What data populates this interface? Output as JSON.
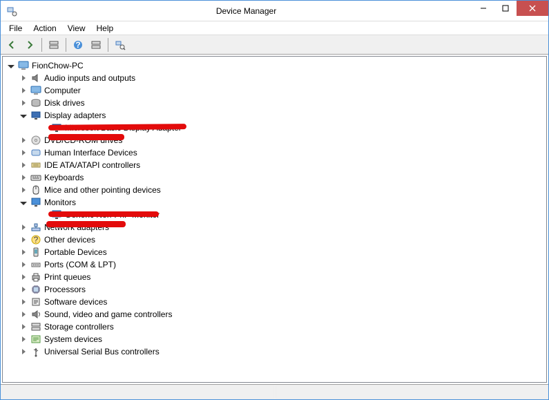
{
  "window": {
    "title": "Device Manager",
    "app_icon": "device-mgr-icon"
  },
  "menu": {
    "file": "File",
    "action": "Action",
    "view": "View",
    "help": "Help"
  },
  "toolbar": {
    "back": "back-icon",
    "forward": "forward-icon",
    "show_hide": "show-hide-icon",
    "help": "help-icon",
    "props": "props-icon",
    "scan": "scan-icon"
  },
  "tree": {
    "root": {
      "label": "FionChow-PC",
      "icon": "computer-icon"
    },
    "nodes": [
      {
        "label": "Audio inputs and outputs",
        "icon": "audio-icon",
        "expanded": false
      },
      {
        "label": "Computer",
        "icon": "computer-icon",
        "expanded": false
      },
      {
        "label": "Disk drives",
        "icon": "disk-icon",
        "expanded": false
      },
      {
        "label": "Display adapters",
        "icon": "display-icon",
        "expanded": true,
        "children": [
          {
            "label": "Microsoft Basic Display Adapter",
            "icon": "display-icon"
          }
        ]
      },
      {
        "label": "DVD/CD-ROM drives",
        "icon": "cd-icon",
        "expanded": false
      },
      {
        "label": "Human Interface Devices",
        "icon": "hid-icon",
        "expanded": false
      },
      {
        "label": "IDE ATA/ATAPI controllers",
        "icon": "ide-icon",
        "expanded": false
      },
      {
        "label": "Keyboards",
        "icon": "keyboard-icon",
        "expanded": false
      },
      {
        "label": "Mice and other pointing devices",
        "icon": "mouse-icon",
        "expanded": false
      },
      {
        "label": "Monitors",
        "icon": "monitor-icon",
        "expanded": true,
        "children": [
          {
            "label": "Generic Non-PnP Monitor",
            "icon": "monitor-icon"
          }
        ]
      },
      {
        "label": "Network adapters",
        "icon": "network-icon",
        "expanded": false
      },
      {
        "label": "Other devices",
        "icon": "other-icon",
        "expanded": false
      },
      {
        "label": "Portable Devices",
        "icon": "portable-icon",
        "expanded": false
      },
      {
        "label": "Ports (COM & LPT)",
        "icon": "port-icon",
        "expanded": false
      },
      {
        "label": "Print queues",
        "icon": "printer-icon",
        "expanded": false
      },
      {
        "label": "Processors",
        "icon": "cpu-icon",
        "expanded": false
      },
      {
        "label": "Software devices",
        "icon": "software-icon",
        "expanded": false
      },
      {
        "label": "Sound, video and game controllers",
        "icon": "sound-icon",
        "expanded": false
      },
      {
        "label": "Storage controllers",
        "icon": "storage-icon",
        "expanded": false
      },
      {
        "label": "System devices",
        "icon": "system-icon",
        "expanded": false
      },
      {
        "label": "Universal Serial Bus controllers",
        "icon": "usb-icon",
        "expanded": false
      }
    ]
  },
  "annotations": {
    "red_underline_1": "display-adapter-highlight",
    "red_underline_2": "monitors-highlight"
  }
}
